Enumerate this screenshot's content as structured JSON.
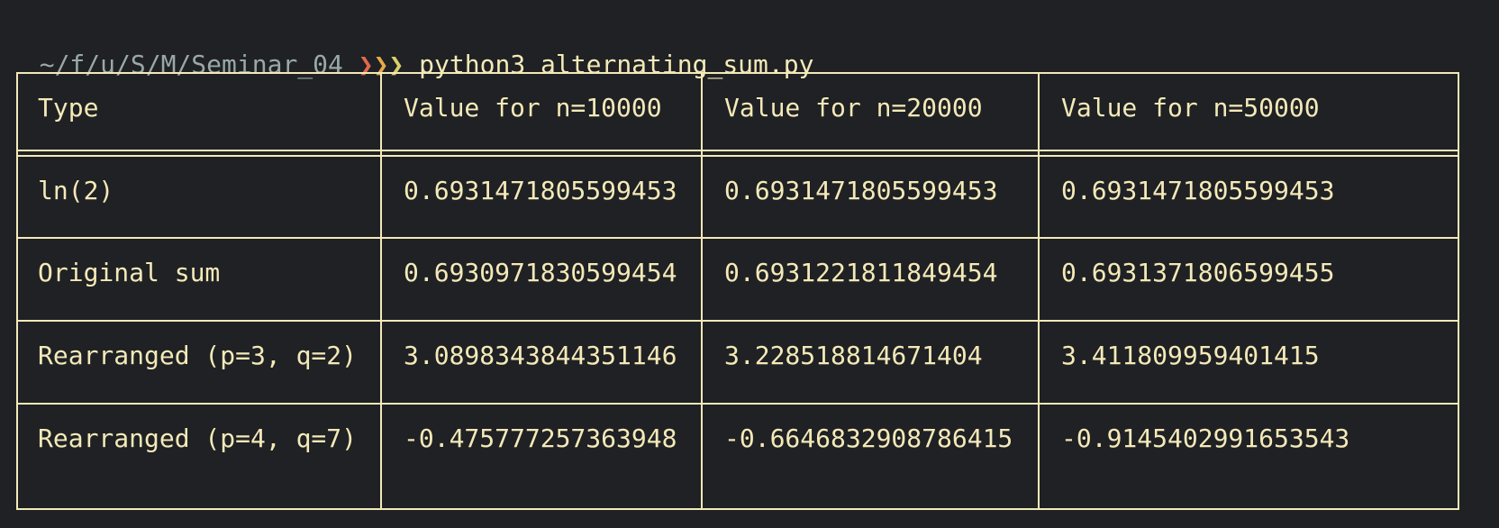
{
  "prompt": {
    "path": "~/f/u/S/M/Seminar_04",
    "arrows": [
      "❯",
      "❯",
      "❯"
    ],
    "command": "python3 alternating_sum.py"
  },
  "table": {
    "headers": [
      "Type",
      "Value for n=10000",
      "Value for n=20000",
      "Value for n=50000"
    ],
    "rows": [
      [
        "ln(2)",
        "0.6931471805599453",
        "0.6931471805599453",
        "0.6931471805599453"
      ],
      [
        "Original sum",
        "0.6930971830599454",
        "0.6931221811849454",
        "0.6931371806599455"
      ],
      [
        "Rearranged (p=3, q=2)",
        "3.0898343844351146",
        "3.228518814671404",
        "3.411809959401415"
      ],
      [
        "Rearranged (p=4, q=7)",
        "-0.475777257363948",
        "-0.6646832908786415",
        "-0.9145402991653543"
      ]
    ]
  },
  "colors": {
    "background": "#1f2124",
    "text": "#f4e9b8",
    "path": "#9aa8a7",
    "arrow1": "#e3694b",
    "arrow2": "#e8a94a",
    "arrow3": "#d9cf6b"
  }
}
